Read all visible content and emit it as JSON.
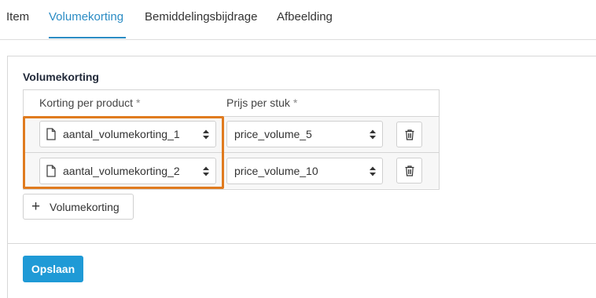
{
  "tabs": [
    {
      "label": "Item",
      "active": false
    },
    {
      "label": "Volumekorting",
      "active": true
    },
    {
      "label": "Bemiddelingsbijdrage",
      "active": false
    },
    {
      "label": "Afbeelding",
      "active": false
    }
  ],
  "section": {
    "title": "Volumekorting",
    "columns": [
      {
        "label": "Korting per product",
        "required_mark": "*"
      },
      {
        "label": "Prijs per stuk",
        "required_mark": "*"
      }
    ],
    "rows": [
      {
        "discount_field": "aantal_volumekorting_1",
        "price_field": "price_volume_5"
      },
      {
        "discount_field": "aantal_volumekorting_2",
        "price_field": "price_volume_10"
      }
    ],
    "add_label": "Volumekorting"
  },
  "footer": {
    "save_label": "Opslaan"
  },
  "colors": {
    "accent": "#2b8cc4",
    "save_button": "#1f9ad6",
    "highlight": "#e07b1f"
  },
  "icons": {
    "field": "document-icon",
    "caret": "sort-caret-icon",
    "delete": "trash-icon",
    "add": "plus-icon"
  }
}
